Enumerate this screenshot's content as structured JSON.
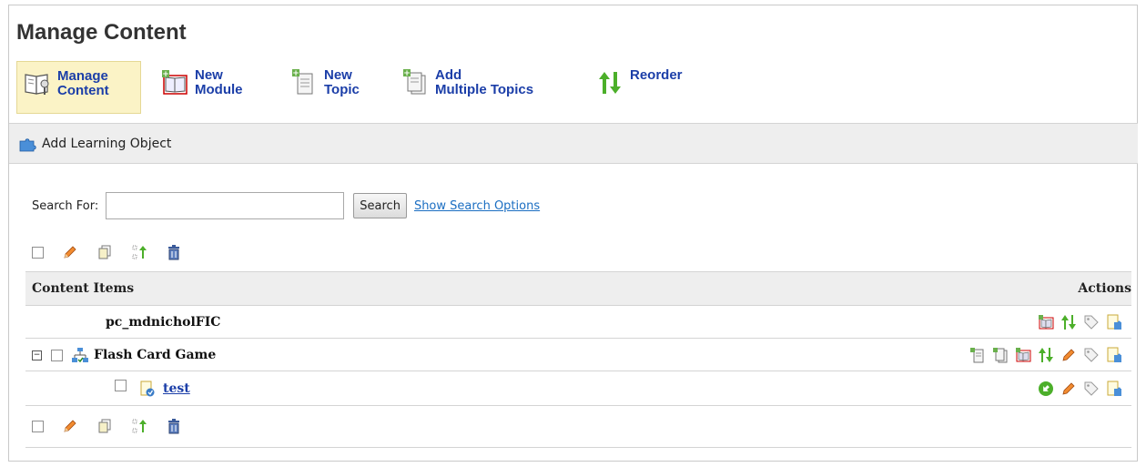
{
  "page": {
    "title": "Manage Content"
  },
  "toolbar": {
    "items": [
      {
        "label": "Manage\nContent",
        "icon": "manage-content-icon"
      },
      {
        "label": "New\nModule",
        "icon": "new-module-icon"
      },
      {
        "label": "New\nTopic",
        "icon": "new-topic-icon"
      },
      {
        "label": "Add\nMultiple Topics",
        "icon": "add-multiple-topics-icon"
      },
      {
        "label": "Reorder",
        "icon": "reorder-icon"
      }
    ]
  },
  "learning_object": {
    "label": "Add Learning Object",
    "icon": "puzzle-icon"
  },
  "search": {
    "label": "Search For:",
    "value": "",
    "placeholder": "",
    "button": "Search",
    "options_link": "Show Search Options"
  },
  "bulk_actions": [
    "edit-icon",
    "copy-icon",
    "move-icon",
    "delete-icon"
  ],
  "table": {
    "header_left": "Content Items",
    "header_right": "Actions",
    "rows": [
      {
        "name": "pc_mdnicholFIC",
        "actions": [
          "new-module-icon",
          "reorder-icon",
          "tag-icon",
          "add-learning-object-icon"
        ]
      },
      {
        "name": "Flash Card Game",
        "actions": [
          "new-topic-icon",
          "add-multiple-topics-icon",
          "new-module-icon",
          "reorder-icon",
          "edit-icon",
          "tag-icon",
          "add-learning-object-icon"
        ]
      },
      {
        "name": "test",
        "actions": [
          "green-arrow-icon",
          "edit-icon",
          "tag-icon",
          "add-learning-object-icon"
        ]
      }
    ]
  },
  "colors": {
    "accent": "#1b3ea8",
    "link": "#1b6ec2",
    "active_bg": "#fbf3c6",
    "bar_bg": "#eeeeee"
  }
}
